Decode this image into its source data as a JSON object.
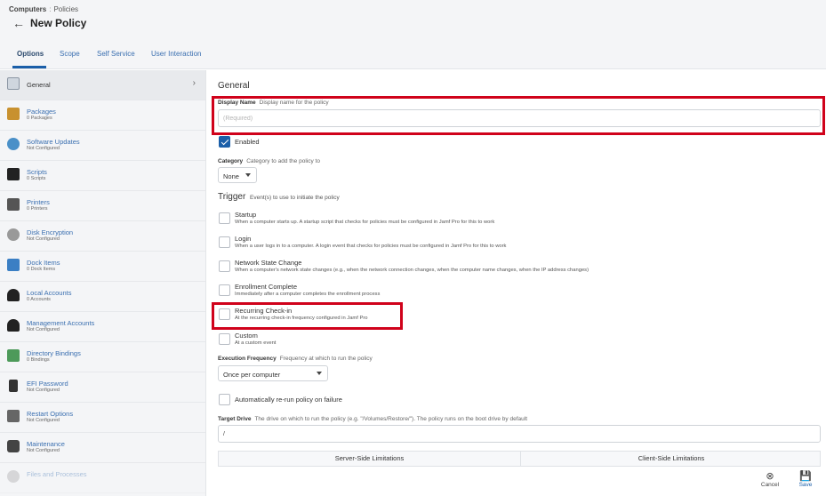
{
  "breadcrumb": {
    "parent": "Computers",
    "separator": ":",
    "current": "Policies"
  },
  "page_title": "New Policy",
  "tabs": [
    {
      "label": "Options"
    },
    {
      "label": "Scope"
    },
    {
      "label": "Self Service"
    },
    {
      "label": "User Interaction"
    }
  ],
  "sidebar": {
    "items": [
      {
        "title": "General",
        "sub": "",
        "icon": "general-icon"
      },
      {
        "title": "Packages",
        "sub": "0 Packages",
        "icon": "package-icon"
      },
      {
        "title": "Software Updates",
        "sub": "Not Configured",
        "icon": "software-update-icon"
      },
      {
        "title": "Scripts",
        "sub": "0 Scripts",
        "icon": "terminal-icon"
      },
      {
        "title": "Printers",
        "sub": "0 Printers",
        "icon": "printer-icon"
      },
      {
        "title": "Disk Encryption",
        "sub": "Not Configured",
        "icon": "disk-icon"
      },
      {
        "title": "Dock Items",
        "sub": "0 Dock Items",
        "icon": "dock-icon"
      },
      {
        "title": "Local Accounts",
        "sub": "0 Accounts",
        "icon": "user-icon"
      },
      {
        "title": "Management Accounts",
        "sub": "Not Configured",
        "icon": "admin-user-icon"
      },
      {
        "title": "Directory Bindings",
        "sub": "0 Bindings",
        "icon": "directory-icon"
      },
      {
        "title": "EFI Password",
        "sub": "Not Configured",
        "icon": "lock-icon"
      },
      {
        "title": "Restart Options",
        "sub": "Not Configured",
        "icon": "restart-icon"
      },
      {
        "title": "Maintenance",
        "sub": "Not Configured",
        "icon": "tools-icon"
      },
      {
        "title": "Files and Processes",
        "sub": "",
        "icon": "search-icon"
      }
    ]
  },
  "general": {
    "section_title": "General",
    "display_name": {
      "label": "Display Name",
      "hint": "Display name for the policy",
      "placeholder": "(Required)",
      "value": ""
    },
    "enabled": {
      "label": "Enabled",
      "checked": true
    },
    "category": {
      "label": "Category",
      "hint": "Category to add the policy to",
      "value": "None"
    },
    "trigger": {
      "title": "Trigger",
      "hint": "Event(s) to use to initiate the policy",
      "options": [
        {
          "label": "Startup",
          "desc": "When a computer starts up. A startup script that checks for policies must be configured in Jamf Pro for this to work"
        },
        {
          "label": "Login",
          "desc": "When a user logs in to a computer. A login event that checks for policies must be configured in Jamf Pro for this to work"
        },
        {
          "label": "Network State Change",
          "desc": "When a computer's network state changes (e.g., when the network connection changes, when the computer name changes, when the IP address changes)"
        },
        {
          "label": "Enrollment Complete",
          "desc": "Immediately after a computer completes the enrollment process"
        },
        {
          "label": "Recurring Check-in",
          "desc": "At the recurring check-in frequency configured in Jamf Pro"
        },
        {
          "label": "Custom",
          "desc": "At a custom event"
        }
      ]
    },
    "execution_frequency": {
      "label": "Execution Frequency",
      "hint": "Frequency at which to run the policy",
      "value": "Once per computer"
    },
    "rerun": {
      "label": "Automatically re-run policy on failure"
    },
    "target_drive": {
      "label": "Target Drive",
      "hint": "The drive on which to run the policy (e.g. \"/Volumes/Restore/\"). The policy runs on the boot drive by default",
      "value": "/"
    },
    "limitations": {
      "server": "Server-Side Limitations",
      "client": "Client-Side Limitations"
    }
  },
  "footer": {
    "cancel": "Cancel",
    "save": "Save"
  },
  "colors": {
    "accent": "#1b5fa9",
    "link": "#3a6fb0",
    "highlight": "#d0021b",
    "panel_bg": "#f4f5f7"
  }
}
